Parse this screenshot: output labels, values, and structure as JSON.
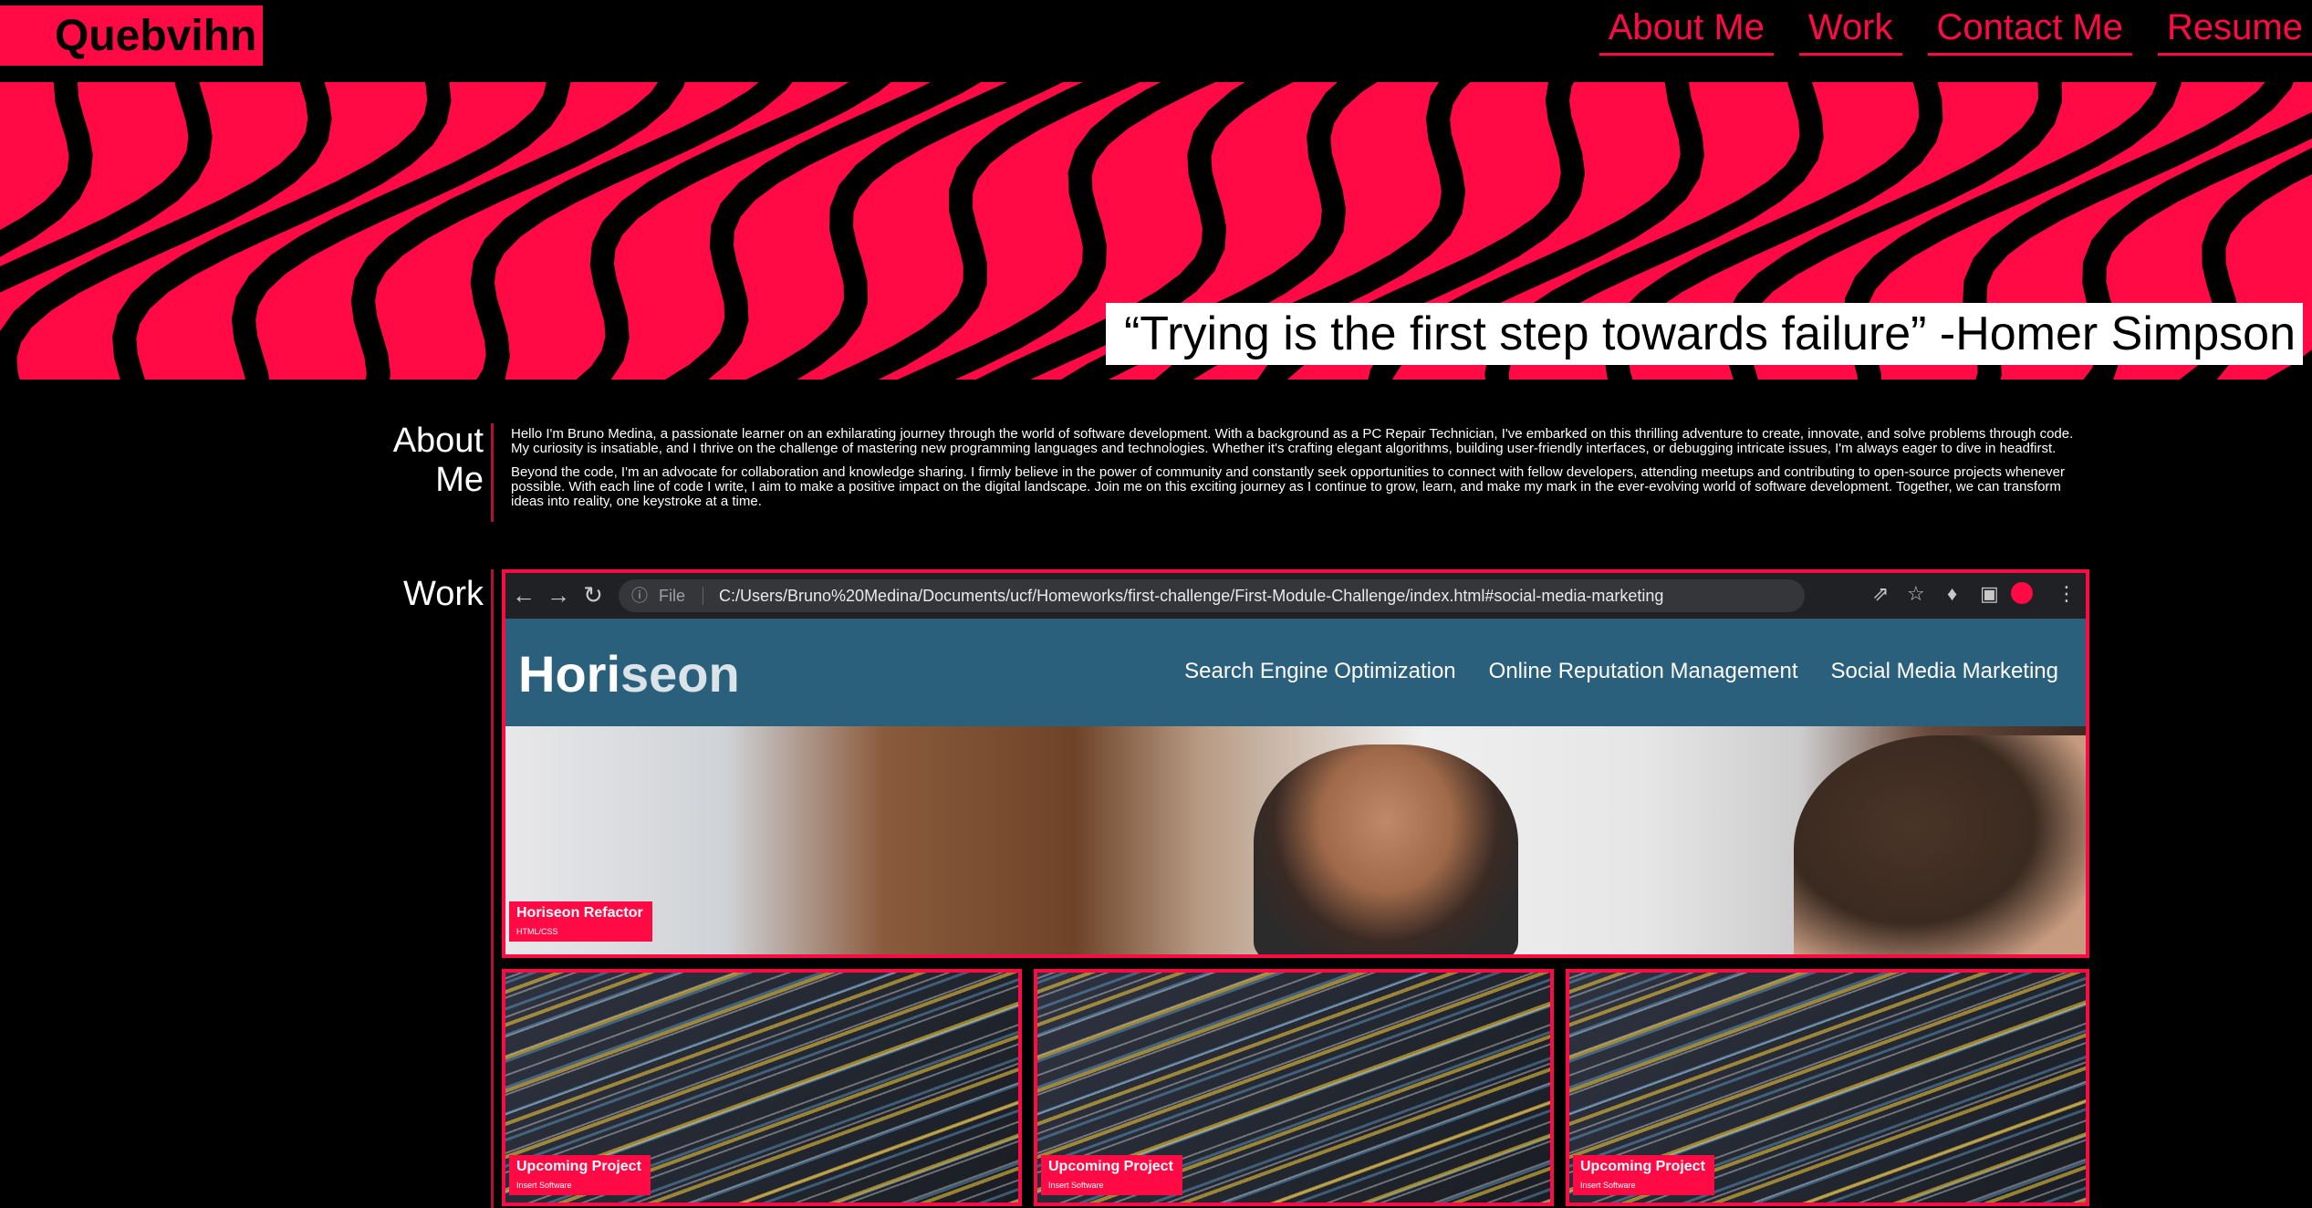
{
  "brand": {
    "name": "Quebvihn",
    "accent": "#ff0a45"
  },
  "nav": [
    {
      "label": "About Me"
    },
    {
      "label": "Work"
    },
    {
      "label": "Contact Me"
    },
    {
      "label": "Resume"
    }
  ],
  "hero": {
    "quote": "“Trying is the first step towards failure” -Homer Simpson"
  },
  "about": {
    "title": "About Me",
    "p1": "Hello I'm Bruno Medina, a passionate learner on an exhilarating journey through the world of software development. With a background as a PC Repair Technician, I've embarked on this thrilling adventure to create, innovate, and solve problems through code. My curiosity is insatiable, and I thrive on the challenge of mastering new programming languages and technologies. Whether it's crafting elegant algorithms, building user-friendly interfaces, or debugging intricate issues, I'm always eager to dive in headfirst.",
    "p2": "Beyond the code, I'm an advocate for collaboration and knowledge sharing. I firmly believe in the power of community and constantly seek opportunities to connect with fellow developers, attending meetups and contributing to open-source projects whenever possible. With each line of code I write, I aim to make a positive impact on the digital landscape. Join me on this exciting journey as I continue to grow, learn, and make my mark in the ever-evolving world of software development. Together, we can transform ideas into reality, one keystroke at a time."
  },
  "work": {
    "title": "Work",
    "featured": {
      "browser": {
        "file_label": "File",
        "url": "C:/Users/Bruno%20Medina/Documents/ucf/Homeworks/first-challenge/First-Module-Challenge/index.html#social-media-marketing"
      },
      "site": {
        "logo_a": "Hori",
        "logo_b": "seon",
        "nav": [
          "Search Engine Optimization",
          "Online Reputation Management",
          "Social Media Marketing"
        ]
      },
      "title": "Horiseon Refactor",
      "subtitle": "HTML/CSS"
    },
    "projects": [
      {
        "title": "Upcoming Project",
        "subtitle": "Insert Software"
      },
      {
        "title": "Upcoming Project",
        "subtitle": "Insert Software"
      },
      {
        "title": "Upcoming Project",
        "subtitle": "Insert Software"
      }
    ]
  }
}
